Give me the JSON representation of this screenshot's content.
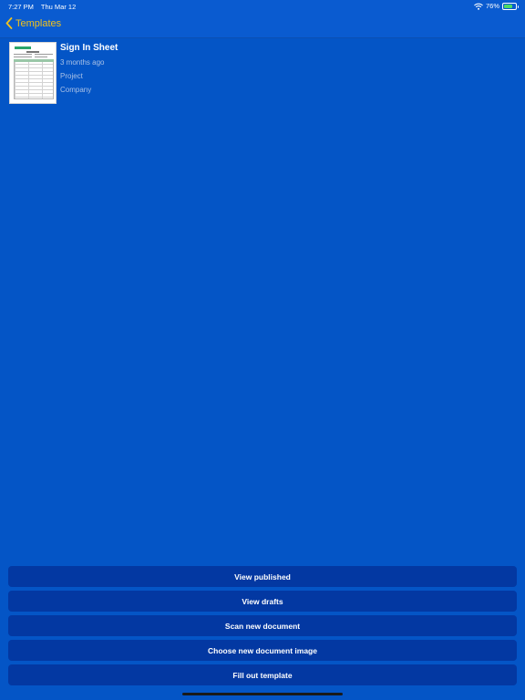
{
  "status_bar": {
    "time": "7:27 PM",
    "date": "Thu Mar 12",
    "battery_percent": "76%",
    "battery_level": 0.76,
    "icons": [
      "wifi-icon",
      "battery-icon"
    ]
  },
  "nav": {
    "back_label": "Templates",
    "back_icon": "chevron-left-icon",
    "accent_color": "#f2c21b"
  },
  "templates": [
    {
      "title": "Sign In Sheet",
      "updated": "3 months ago",
      "project": "Project",
      "company": "Company"
    }
  ],
  "actions": [
    "View published",
    "View drafts",
    "Scan new document",
    "Choose new document image",
    "Fill out template"
  ],
  "colors": {
    "background": "#0455c6",
    "button": "#0338a2",
    "text": "#ffffff",
    "secondary_text": "#a9c1e6"
  }
}
